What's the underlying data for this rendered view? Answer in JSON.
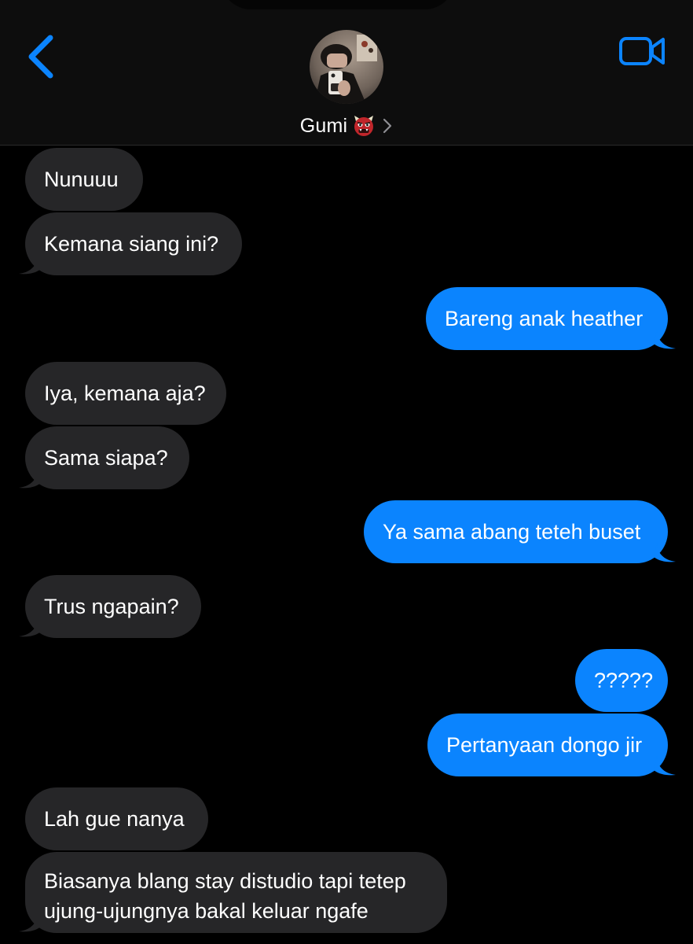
{
  "header": {
    "contact_name": "Gumi",
    "contact_emoji": "👹"
  },
  "icons": {
    "back": "chevron-left-icon",
    "video": "video-camera-icon",
    "emoji": "ogre-face-icon",
    "disclosure": "chevron-right-icon"
  },
  "colors": {
    "accent": "#0b84fe",
    "incoming_bubble": "#262628",
    "background": "#000000"
  },
  "messages": [
    {
      "side": "in",
      "text": "Nunuuu"
    },
    {
      "side": "in",
      "text": "Kemana siang ini?"
    },
    {
      "side": "out",
      "text": "Bareng anak heather"
    },
    {
      "side": "in",
      "text": "Iya, kemana aja?"
    },
    {
      "side": "in",
      "text": "Sama siapa?"
    },
    {
      "side": "out",
      "text": "Ya sama abang teteh buset"
    },
    {
      "side": "in",
      "text": "Trus ngapain?"
    },
    {
      "side": "out",
      "text": "?????"
    },
    {
      "side": "out",
      "text": "Pertanyaan dongo jir"
    },
    {
      "side": "in",
      "text": "Lah gue nanya"
    },
    {
      "side": "in",
      "text": "Biasanya blang stay distudio tapi tetep ujung-ujungnya bakal keluar ngafe"
    }
  ]
}
